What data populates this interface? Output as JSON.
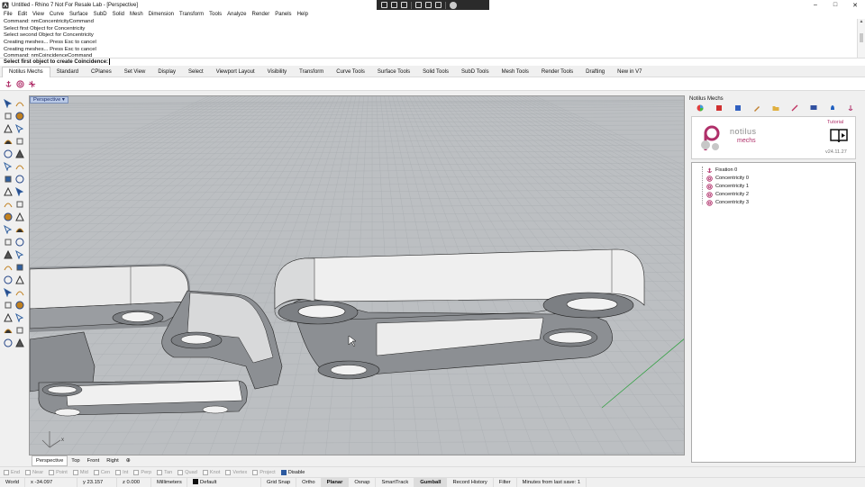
{
  "window": {
    "title": "Untitled - Rhino 7 Not For Resale Lab - [Perspective]",
    "controls": {
      "minimize": "–",
      "maximize": "□",
      "close": "✕"
    }
  },
  "menu": [
    "File",
    "Edit",
    "View",
    "Curve",
    "Surface",
    "SubD",
    "Solid",
    "Mesh",
    "Dimension",
    "Transform",
    "Tools",
    "Analyze",
    "Render",
    "Panels",
    "Help"
  ],
  "command_history": [
    "Command: nmConcentricityCommand",
    "Select first Object for Concentricity",
    "Select second Object for Concentricity",
    "Creating meshes... Press Esc to cancel",
    "Creating meshes... Press Esc to cancel",
    "Command: nmCoincidenceCommand"
  ],
  "command_prompt": "Select first object to create Coincidence:",
  "toolbar_tabs": [
    "Notilus Mechs",
    "Standard",
    "CPlanes",
    "Set View",
    "Display",
    "Select",
    "Viewport Layout",
    "Visibility",
    "Transform",
    "Curve Tools",
    "Surface Tools",
    "Solid Tools",
    "SubD Tools",
    "Mesh Tools",
    "Render Tools",
    "Drafting",
    "New in V7"
  ],
  "active_toolbar_tab": "Notilus Mechs",
  "viewport": {
    "name": "Perspective",
    "axis_x": "x",
    "axis_y": "y",
    "axis_z": "z",
    "background_color": "#bcbfc2",
    "grid_color": "#a9adb1"
  },
  "viewport_tabs": [
    "Perspective",
    "Top",
    "Front",
    "Right"
  ],
  "viewport_tab_add": "⊕",
  "panel": {
    "title": "Notilus Mechs",
    "logo_text": "notilus",
    "logo_sub": "mechs",
    "tutorial_label": "Tutorial",
    "version": "v24.11.27",
    "tree": [
      {
        "label": "Fixation 0",
        "icon": "anchor-icon"
      },
      {
        "label": "Concentricity 0",
        "icon": "concentric-icon"
      },
      {
        "label": "Concentricity 1",
        "icon": "concentric-icon"
      },
      {
        "label": "Concentricity 2",
        "icon": "concentric-icon"
      },
      {
        "label": "Concentricity 3",
        "icon": "concentric-icon"
      }
    ]
  },
  "osnaps": [
    {
      "label": "End",
      "on": false
    },
    {
      "label": "Near",
      "on": false
    },
    {
      "label": "Point",
      "on": false
    },
    {
      "label": "Mid",
      "on": false
    },
    {
      "label": "Cen",
      "on": false
    },
    {
      "label": "Int",
      "on": false
    },
    {
      "label": "Perp",
      "on": false
    },
    {
      "label": "Tan",
      "on": false
    },
    {
      "label": "Quad",
      "on": false
    },
    {
      "label": "Knot",
      "on": false
    },
    {
      "label": "Vertex",
      "on": false
    },
    {
      "label": "Project",
      "on": false
    },
    {
      "label": "Disable",
      "on": true
    }
  ],
  "status": {
    "cplane": "World",
    "x": "x -34.097",
    "y": "y 23.157",
    "z": "z 0.000",
    "units": "Millimeters",
    "layer": "Default",
    "toggles": [
      "Grid Snap",
      "Ortho",
      "Planar",
      "Osnap",
      "SmartTrack",
      "Gumball",
      "Record History",
      "Filter"
    ],
    "bold_toggles": [
      "Planar",
      "Gumball"
    ],
    "message": "Minutes from last save: 1"
  },
  "colors": {
    "accent": "#b0306a",
    "link_face": "#ececec",
    "link_shadow": "#8c8f93",
    "x_axis": "#c03030",
    "y_axis": "#30a040"
  }
}
